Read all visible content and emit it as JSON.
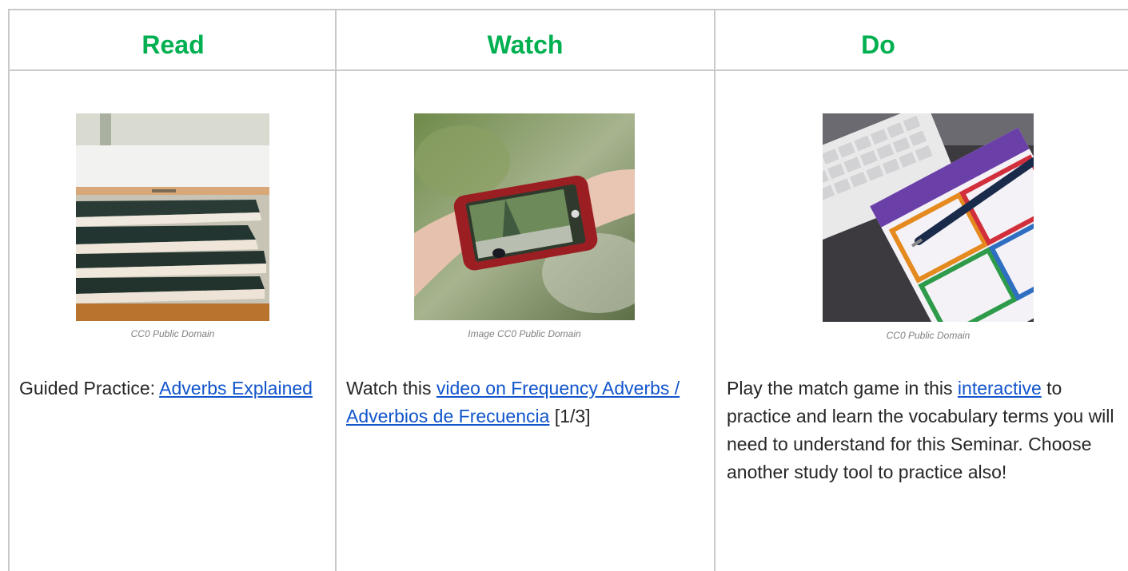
{
  "columns": {
    "read": {
      "heading": "Read",
      "caption": "CC0 Public Domain",
      "prefix": "Guided Practice: ",
      "link": "Adverbs Explained"
    },
    "watch": {
      "heading": "Watch",
      "caption": "Image CC0 Public Domain",
      "prefix": "Watch this ",
      "link": "video on Frequency Adverbs / Adverbios de Frecuencia",
      "suffix": " [1/3]"
    },
    "do": {
      "heading": "Do",
      "caption": "CC0 Public Domain",
      "prefix": "Play the match game in this ",
      "link": "interactive",
      "suffix": " to practice and learn the vocabulary terms you will need to understand for this Seminar.  Choose another study tool to practice also!"
    }
  },
  "colors": {
    "heading": "#00b050",
    "link": "#1155cc",
    "border": "#c9c9c9"
  }
}
